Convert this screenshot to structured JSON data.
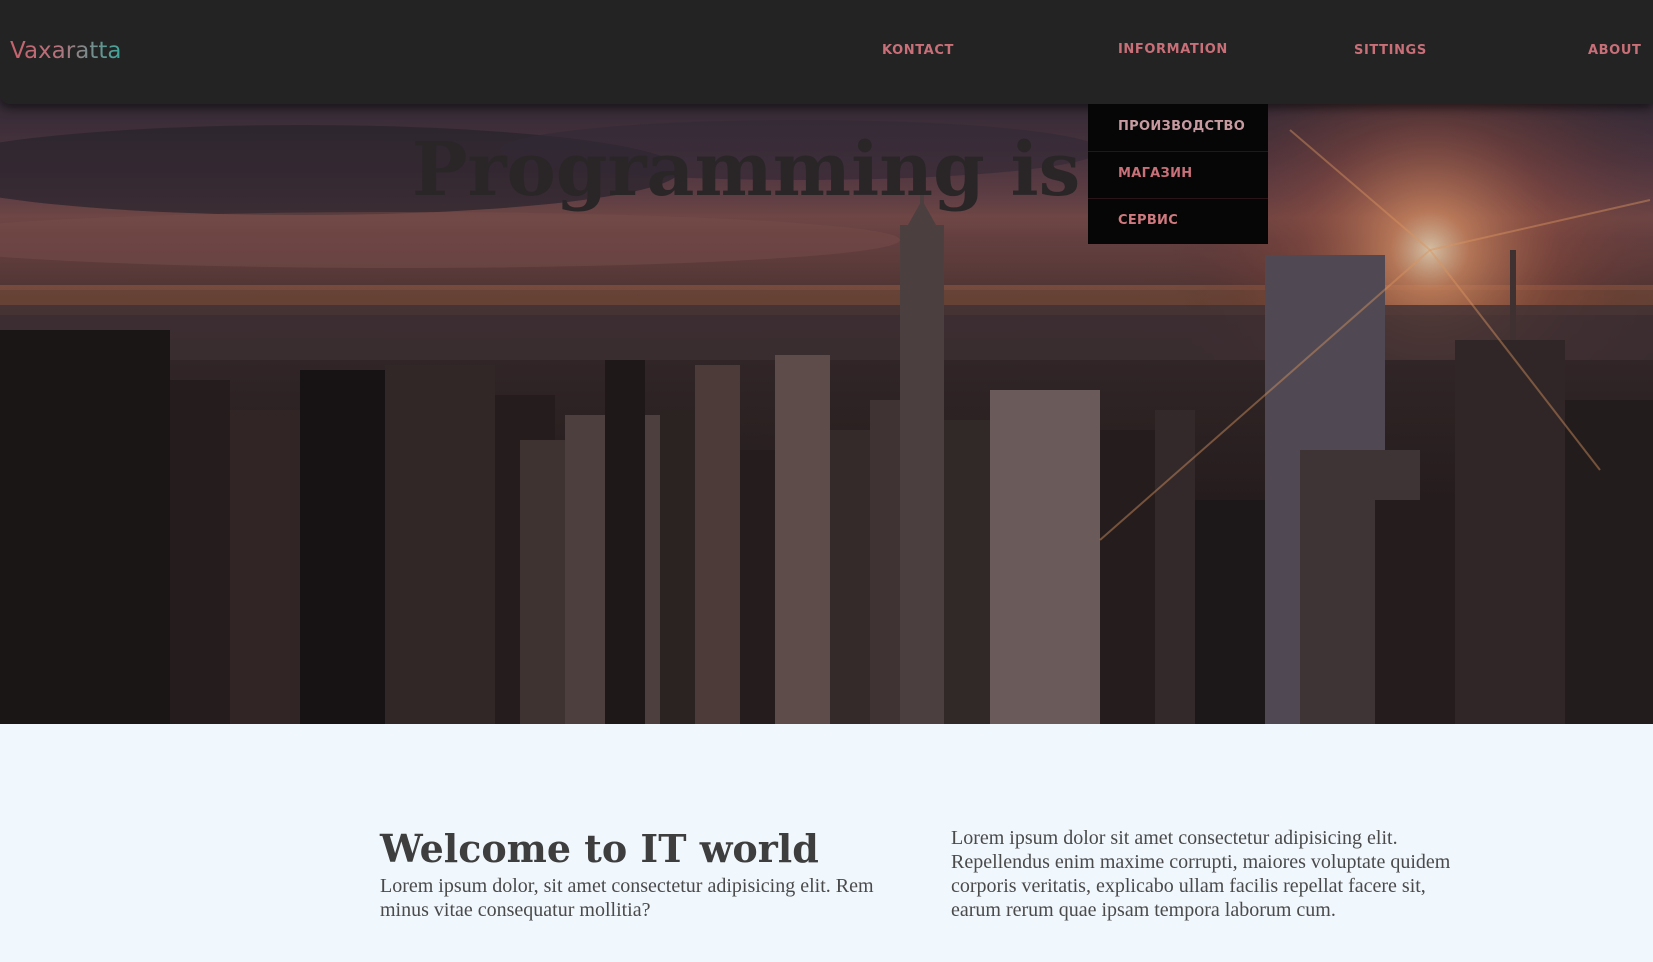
{
  "navbar": {
    "brand": "Vaxaratta",
    "links": {
      "kontact": "KONTACT",
      "information": "INFORMATION",
      "sittings": "SITTINGS",
      "about": "ABOUT"
    },
    "dropdown": {
      "items": [
        "ПРОИЗВОДСТВО",
        "МАГАЗИН",
        "СЕРВИС"
      ]
    }
  },
  "hero": {
    "title": "Programming is life",
    "image": "city-skyline-sunset"
  },
  "content": {
    "welcome_title": "Welcome to IT world",
    "welcome_text": "Lorem ipsum dolor, sit amet consectetur adipisicing elit. Rem minus vitae consequatur mollitia?",
    "side_text": "Lorem ipsum dolor sit amet consectetur adipisicing elit. Repellendus enim maxime corrupti, maiores voluptate quidem corporis veritatis, explicabo ullam facilis repellat facere sit, earum rerum quae ipsam tempora laborum cum."
  },
  "colors": {
    "navbar_bg": "#232323",
    "nav_link": "#c86f78",
    "dropdown_bg": "#060606",
    "content_bg": "#f0f7fd",
    "heading": "#3e3e3e"
  }
}
